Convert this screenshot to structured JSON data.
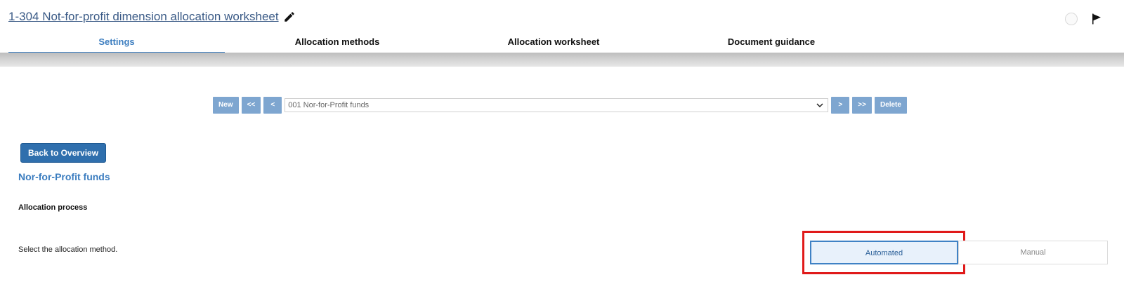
{
  "header": {
    "title": "1-304 Not-for-profit dimension allocation worksheet",
    "icons": [
      "pencil-icon",
      "status-circle-icon",
      "flag-icon"
    ]
  },
  "tabs": [
    {
      "label": "Settings",
      "active": true
    },
    {
      "label": "Allocation methods",
      "active": false
    },
    {
      "label": "Allocation worksheet",
      "active": false
    },
    {
      "label": "Document guidance",
      "active": false
    }
  ],
  "navigator": {
    "new_label": "New",
    "first_label": "<<",
    "prev_label": "<",
    "selected": "001 Nor-for-Profit funds",
    "next_label": ">",
    "last_label": ">>",
    "delete_label": "Delete"
  },
  "main": {
    "back_label": "Back to Overview",
    "section_title": "Nor-for-Profit funds",
    "process_label": "Allocation process",
    "method_prompt": "Select the allocation method.",
    "options": [
      {
        "label": "Automated",
        "selected": true
      },
      {
        "label": "Manual",
        "selected": false
      }
    ]
  },
  "colors": {
    "accent": "#3f7fc0",
    "nav_button": "#7ea6d0",
    "back_button": "#2f6fad",
    "highlight": "#e01a1a"
  }
}
